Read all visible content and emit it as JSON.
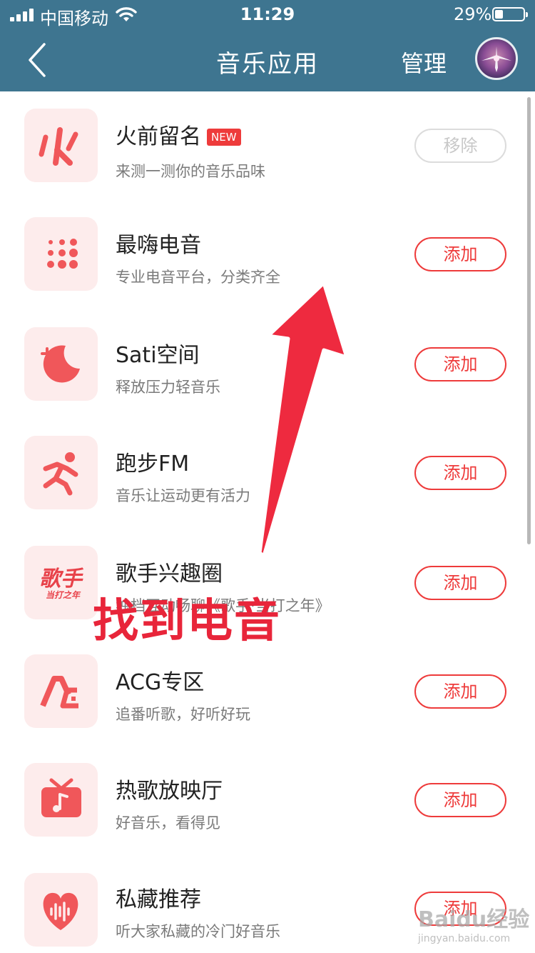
{
  "status_bar": {
    "carrier": "中国移动",
    "time": "11:29",
    "battery_percent": "29%",
    "battery_level": 0.29
  },
  "nav": {
    "back_icon": "chevron-left-icon",
    "title": "音乐应用",
    "manage_label": "管理",
    "avatar_icon": "avatar-icon"
  },
  "list": {
    "items": [
      {
        "title": "火前留名",
        "badge": "NEW",
        "subtitle": "来测一测你的音乐品味",
        "button": "移除",
        "icon": "flame-logo-icon"
      },
      {
        "title": "最嗨电音",
        "subtitle": "专业电音平台，分类齐全",
        "button": "添加",
        "icon": "dots-grid-icon"
      },
      {
        "title": "Sati空间",
        "subtitle": "释放压力轻音乐",
        "button": "添加",
        "icon": "moon-icon"
      },
      {
        "title": "跑步FM",
        "subtitle": "音乐让运动更有活力",
        "button": "添加",
        "icon": "runner-icon"
      },
      {
        "title": "歌手兴趣圈",
        "subtitle": "独档互动畅聊《歌手·当打之年》",
        "button": "添加",
        "icon": "singer-logo-icon"
      },
      {
        "title": "ACG专区",
        "subtitle": "追番听歌，好听好玩",
        "button": "添加",
        "icon": "acg-logo-icon"
      },
      {
        "title": "热歌放映厅",
        "subtitle": "好音乐，看得见",
        "button": "添加",
        "icon": "tv-music-icon"
      },
      {
        "title": "私藏推荐",
        "subtitle": "听大家私藏的冷门好音乐",
        "button": "添加",
        "icon": "heart-wave-icon"
      }
    ]
  },
  "annotation": {
    "text": "找到电音",
    "icon": "arrow-up-icon"
  },
  "watermark": {
    "logo": "Baidu经验",
    "url": "jingyan.baidu.com"
  },
  "colors": {
    "header": "#3e7590",
    "accent": "#ee3b3b",
    "icon_bg": "#fdecec",
    "icon_fg": "#f0575a"
  }
}
